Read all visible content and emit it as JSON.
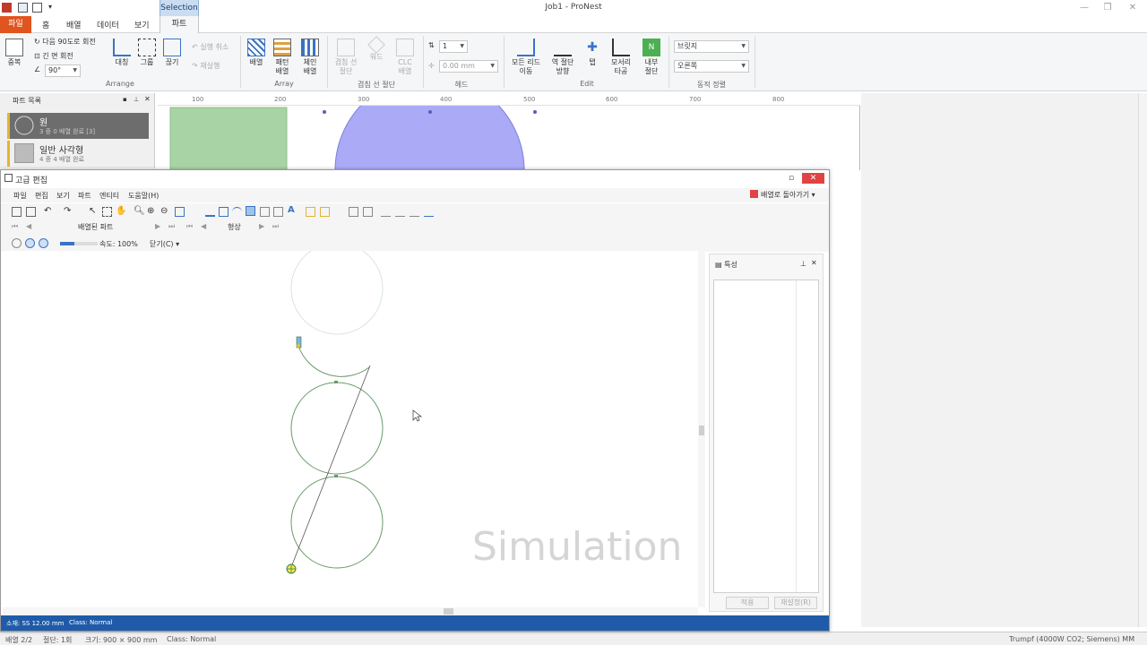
{
  "app": {
    "title": "Job1 - ProNest",
    "context_tab_group": "Selection",
    "window_controls": {
      "minimize": "—",
      "restore": "❐",
      "close": "✕"
    }
  },
  "ribbon_tabs": [
    "파일",
    "홈",
    "배열",
    "데이터",
    "보기",
    "파트"
  ],
  "ribbon": {
    "duplicate": "중복",
    "rotate_next_90": "다음 90도로 회전",
    "long_side_rotate": "긴 면 회전",
    "angle_value": "90°",
    "mirror": "대칭",
    "group": "그룹",
    "explode": "끊기",
    "undo_exec": "실행 취소",
    "redo_exec": "재실행",
    "arrange_group": "Arrange",
    "array": "배열",
    "pattern_array": [
      "패턴",
      "배열"
    ],
    "chain_array": [
      "체인",
      "배열"
    ],
    "array_group": "Array",
    "common_line_cut": [
      "겹침 선",
      "절단"
    ],
    "bridge": "워드",
    "clc_array": [
      "CLC",
      "배열"
    ],
    "common_line_group": "겹침 선 절단",
    "head_count": "1",
    "head_offset": "0.00 mm",
    "head_group": "헤드",
    "move_all_leads": [
      "모든 리드",
      "이동"
    ],
    "reverse_cut_dir": [
      "역 절단",
      "방향"
    ],
    "tab": "탭",
    "corner_loop": [
      "모서리",
      "타공"
    ],
    "interior_cut": [
      "내부",
      "절단"
    ],
    "edit_group": "Edit",
    "auto_sort_1": "브릿지",
    "auto_sort_2": "오른쪽",
    "sort_group": "동적 정렬"
  },
  "parts_panel": {
    "title": "파트 목록",
    "items": [
      {
        "name": "원",
        "status": "3 중 0 배열 완료 [3]"
      },
      {
        "name": "일반 사각형",
        "status": "4 중 4 배열 완료"
      }
    ]
  },
  "ruler_labels": [
    "100",
    "200",
    "300",
    "400",
    "500",
    "600",
    "700",
    "800"
  ],
  "dialog": {
    "title": "고급 편집",
    "menu": [
      "파일",
      "편집",
      "보기",
      "파트",
      "엔티티",
      "도움말(H)"
    ],
    "goto_array": "배열로 돌아가기",
    "arrayed_parts": "배열된 파트",
    "shape": "형상",
    "speed": "속도: 100%",
    "close": "닫기(C)",
    "watermark": "Simulation",
    "properties": {
      "title": "특성",
      "apply": "적용",
      "reset": "재설정(R)"
    },
    "status": {
      "material": "소재: SS 12.00 mm",
      "class": "Class: Normal"
    }
  },
  "main_status": {
    "array": "배열 2/2",
    "cut": "절단: 1회",
    "size": "크기: 900 × 900 mm",
    "class": "Class: Normal",
    "machine": "Trumpf (4000W CO2; Siemens) MM"
  },
  "colors": {
    "file_tab": "#e0541f",
    "selection_tab": "#c9dcf1",
    "dialog_status": "#1f5ba8",
    "part_rect": "#a8d3a4",
    "part_circle": "#aaaaf7",
    "path_green": "#6a9a6a",
    "close_red": "#e04343"
  }
}
